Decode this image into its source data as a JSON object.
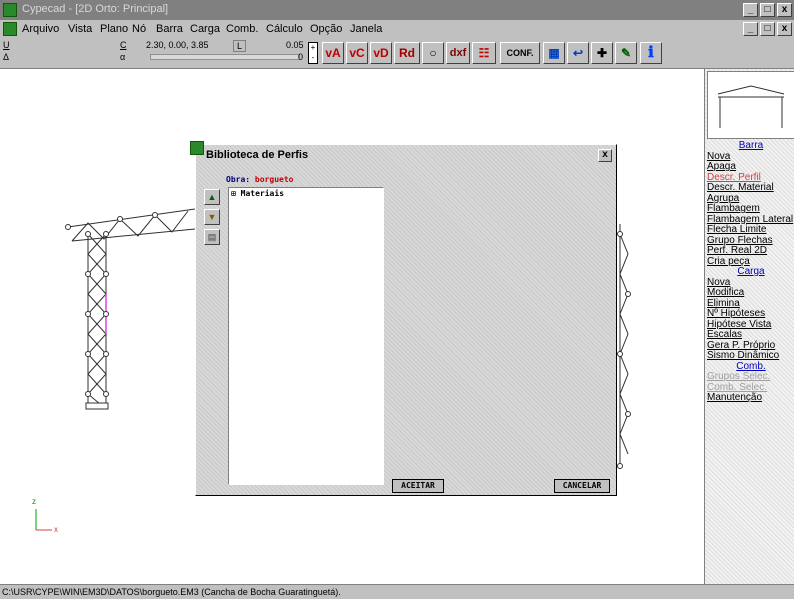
{
  "window": {
    "title": "Cypecad - [2D Orto: Principal]",
    "min": "_",
    "max": "□",
    "close": "x"
  },
  "menu": [
    "Arquivo",
    "Vista",
    "Plano",
    "Nó",
    "Barra",
    "Carga",
    "Comb.",
    "Cálculo",
    "Opção",
    "Janela"
  ],
  "toolbar": {
    "u": "U",
    "delta": "Δ",
    "c": "C",
    "alpha": "α",
    "coords": "2.30, 0.00, 3.85",
    "l": "L",
    "lval": "0.05",
    "zero": "0",
    "btns": [
      "vA",
      "vC",
      "vD",
      "Rd",
      "○",
      "dxf",
      "☷",
      "CONF.",
      "▦",
      "↩",
      "✚",
      "✎",
      "ℹ"
    ]
  },
  "status": "C:\\USR\\CYPE\\WIN\\EM3D\\DATOS\\borgueto.EM3 (Cancha de Bocha Guaratinguetá).",
  "axes": {
    "z": "z",
    "x": "x"
  },
  "panel": {
    "items": [
      {
        "t": "Barra",
        "k": "header"
      },
      {
        "t": "Nova"
      },
      {
        "t": "Apaga"
      },
      {
        "t": "Descr. Perfil",
        "k": "red"
      },
      {
        "t": "Descr. Material"
      },
      {
        "t": "Agrupa"
      },
      {
        "t": "Flambagem"
      },
      {
        "t": "Flambagem Lateral"
      },
      {
        "t": "Flecha Limite"
      },
      {
        "t": "Grupo Flechas"
      },
      {
        "t": "Perf. Real 2D"
      },
      {
        "t": "Cria peça"
      },
      {
        "t": "Carga",
        "k": "header"
      },
      {
        "t": "Nova"
      },
      {
        "t": "Modifica"
      },
      {
        "t": "Elimina"
      },
      {
        "t": "Nº Hipóteses"
      },
      {
        "t": "Hipótese Vista"
      },
      {
        "t": "Escalas"
      },
      {
        "t": "Gera P. Próprio"
      },
      {
        "t": "Sismo Dinâmico"
      },
      {
        "t": "Comb.",
        "k": "header"
      },
      {
        "t": "Grupos Selec.",
        "k": "gray"
      },
      {
        "t": "Comb. Selec.",
        "k": "gray"
      },
      {
        "t": "Manutenção"
      }
    ]
  },
  "dialog": {
    "title": "Biblioteca de Perfis",
    "close": "x",
    "obra_label": "Obra:",
    "obra_value": "borgueto",
    "tree_root": "Materiais",
    "ok": "ACEITAR",
    "cancel": "CANCELAR"
  }
}
